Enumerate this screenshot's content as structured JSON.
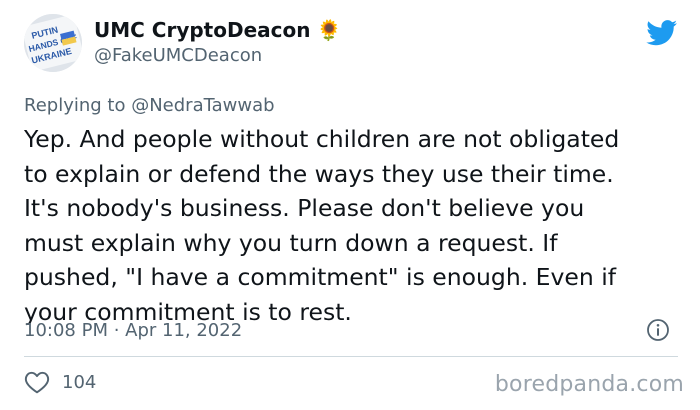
{
  "author": {
    "display_name": "UMC CryptoDeacon",
    "handle": "@FakeUMCDeacon",
    "emoji": "🌻",
    "avatar_sign": [
      "PUTIN",
      "HANDS OFF",
      "UKRAINE"
    ]
  },
  "reply": {
    "prefix": "Replying to",
    "mention": "@NedraTawwab"
  },
  "body": {
    "text": "Yep. And people without children are not obligated\nto explain or defend the ways they use their time.\nIt's nobody's business. Please don't believe you\nmust explain why you turn down a request. If\npushed, \"I have a commitment\" is enough. Even if\nyour commitment is to rest."
  },
  "meta": {
    "timestamp": "10:08 PM · Apr 11, 2022"
  },
  "engagement": {
    "likes": "104"
  },
  "watermark": "boredpanda.com",
  "colors": {
    "twitter_blue": "#1d9bf0",
    "secondary_text": "#536471",
    "primary_text": "#0f1419"
  },
  "icons": {
    "logo": "twitter-bird-icon",
    "info": "info-icon",
    "like": "heart-icon"
  }
}
